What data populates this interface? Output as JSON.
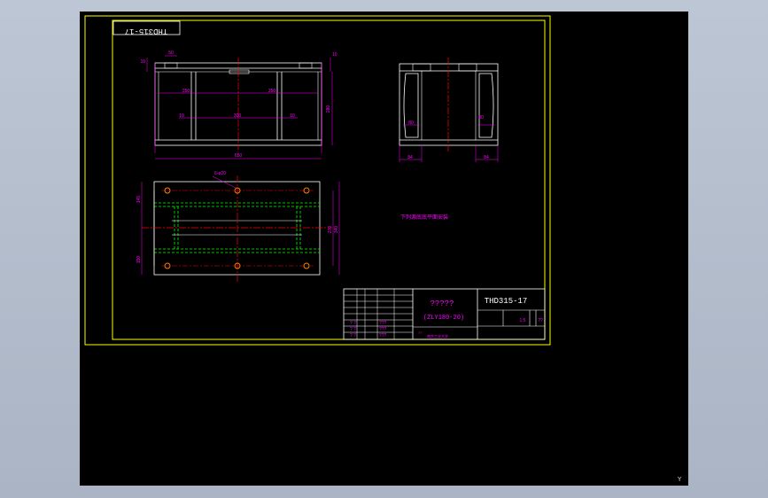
{
  "drawing": {
    "mirrored_code": "THD315-17",
    "views": {
      "front": {
        "dim_top_50": "50",
        "dim_left_10": "10",
        "dim_right_10": "10",
        "dim_height": "280",
        "dim_250_left": "250",
        "dim_250_right": "250",
        "dim_10_a": "10",
        "dim_10_b": "10",
        "dim_300": "300",
        "dim_width": "650"
      },
      "side": {
        "dim_80_left": "80",
        "dim_80_right": "80",
        "dim_84_left": "84",
        "dim_84_right": "84"
      },
      "plan": {
        "hole_note": "6-ø20",
        "dim_left_top": "145",
        "dim_left_bottom": "150",
        "dim_right_a": "270",
        "dim_right_b": "340"
      }
    },
    "note": "下列源底底平面安装",
    "title_block": {
      "name": "?????",
      "spec": "(ZLY180-20)",
      "code": "THD315-17",
      "scale": "1:5",
      "small_cell": "??",
      "signatures": [
        "? ?",
        "? ?",
        "? ?"
      ],
      "footer_a": "??",
      "footer_b": "南京工业大学",
      "marks": [
        "???",
        "???",
        "???"
      ]
    },
    "colors": {
      "frame": "#ffff00",
      "outline": "#ffffff",
      "dimension": "#ff00ff",
      "centerline": "#ff0000",
      "hidden": "#00ff00",
      "hole": "#ff8800",
      "background": "#000000"
    }
  },
  "status": {
    "ucs_mark": "Y"
  }
}
